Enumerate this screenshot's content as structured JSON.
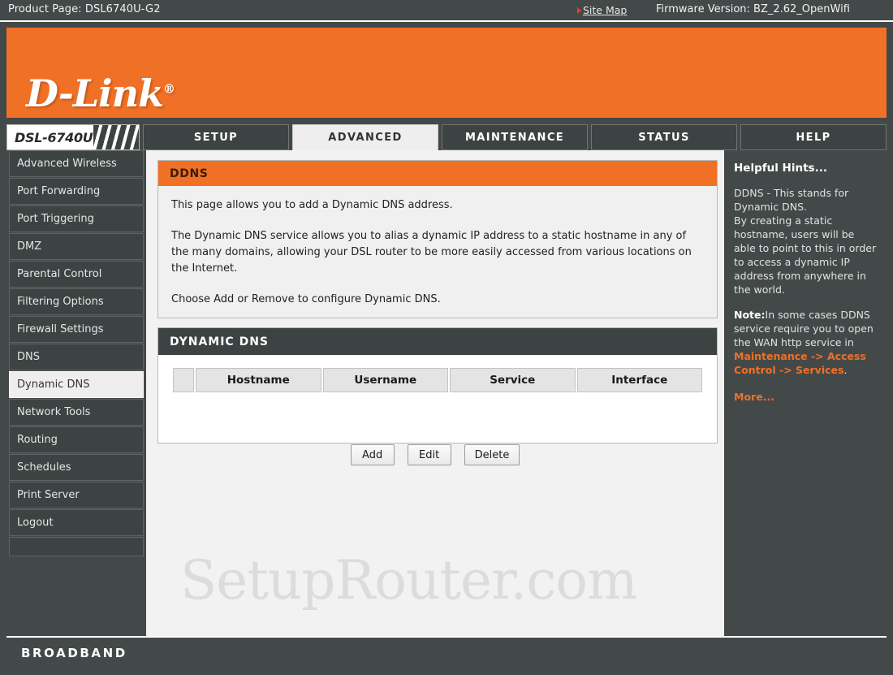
{
  "topbar": {
    "product_page": "Product Page: DSL6740U-G2",
    "site_map": "Site Map",
    "firmware": "Firmware Version: BZ_2.62_OpenWifi"
  },
  "brand": {
    "logo": "D-Link",
    "registered": "®",
    "model": "DSL-6740U"
  },
  "nav": {
    "tabs": [
      {
        "label": "SETUP",
        "active": false
      },
      {
        "label": "ADVANCED",
        "active": true
      },
      {
        "label": "MAINTENANCE",
        "active": false
      },
      {
        "label": "STATUS",
        "active": false
      },
      {
        "label": "HELP",
        "active": false
      }
    ]
  },
  "sidebar": {
    "items": [
      {
        "label": "Advanced Wireless",
        "active": false
      },
      {
        "label": "Port Forwarding",
        "active": false
      },
      {
        "label": "Port Triggering",
        "active": false
      },
      {
        "label": "DMZ",
        "active": false
      },
      {
        "label": "Parental Control",
        "active": false
      },
      {
        "label": "Filtering Options",
        "active": false
      },
      {
        "label": "Firewall Settings",
        "active": false
      },
      {
        "label": "DNS",
        "active": false
      },
      {
        "label": "Dynamic DNS",
        "active": true
      },
      {
        "label": "Network Tools",
        "active": false
      },
      {
        "label": "Routing",
        "active": false
      },
      {
        "label": "Schedules",
        "active": false
      },
      {
        "label": "Print Server",
        "active": false
      },
      {
        "label": "Logout",
        "active": false
      }
    ]
  },
  "ddns_panel": {
    "title": "DDNS",
    "paragraphs": [
      "This page allows you to add a Dynamic DNS address.",
      "The Dynamic DNS service allows you to alias a dynamic IP address to a static hostname in any of the many domains, allowing your DSL router to be more easily accessed from various locations on the Internet.",
      "Choose Add or Remove to configure Dynamic DNS."
    ]
  },
  "dynamic_dns": {
    "title": "DYNAMIC DNS",
    "columns": [
      "",
      "Hostname",
      "Username",
      "Service",
      "Interface"
    ],
    "rows": []
  },
  "buttons": {
    "add": "Add",
    "edit": "Edit",
    "delete": "Delete"
  },
  "hints": {
    "title": "Helpful Hints...",
    "body1": "DDNS - This stands for Dynamic DNS.",
    "body2": "By creating a static hostname, users will be able to point to this in order to access a dynamic IP address from anywhere in the world.",
    "note_label": "Note:",
    "note_text": "In some cases DDNS service require you to open the WAN http service in ",
    "note_link": "Maintenance -> Access Control -> Services",
    "note_tail": ".",
    "more": "More..."
  },
  "watermark": "SetupRouter.com",
  "footer": {
    "broadband": "BROADBAND"
  },
  "colors": {
    "orange": "#f07026",
    "dark": "#434948",
    "panel_dark": "#3d4342",
    "accent_link": "#f07026",
    "sitemap_arrow": "#e8402a"
  }
}
